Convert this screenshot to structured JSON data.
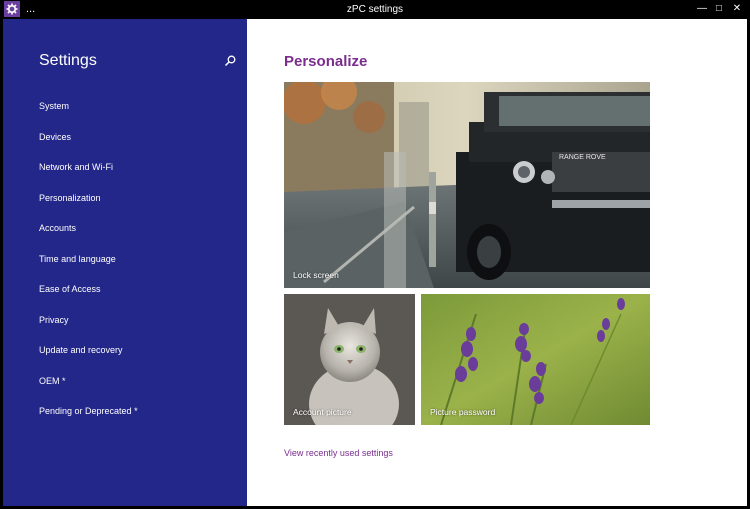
{
  "window": {
    "title": "zPC settings",
    "menu_glyph": "...",
    "app_icon": "gear-icon",
    "minimize_glyph": "—",
    "maximize_glyph": "□",
    "close_glyph": "✕"
  },
  "sidebar": {
    "title": "Settings",
    "search_icon": "search-icon",
    "items": [
      {
        "label": "System"
      },
      {
        "label": "Devices"
      },
      {
        "label": "Network and Wi-Fi"
      },
      {
        "label": "Personalization"
      },
      {
        "label": "Accounts"
      },
      {
        "label": "Time and language"
      },
      {
        "label": "Ease of Access"
      },
      {
        "label": "Privacy"
      },
      {
        "label": "Update and recovery"
      },
      {
        "label": "OEM *"
      },
      {
        "label": "Pending or Deprecated *"
      }
    ]
  },
  "main": {
    "title": "Personalize",
    "tiles": {
      "lock_screen": "Lock screen",
      "account_picture": "Account picture",
      "picture_password": "Picture password"
    },
    "recent_link": "View recently used settings"
  },
  "colors": {
    "sidebar_bg": "#232789",
    "accent": "#7b2d8e",
    "titlebar_bg": "#000000"
  }
}
